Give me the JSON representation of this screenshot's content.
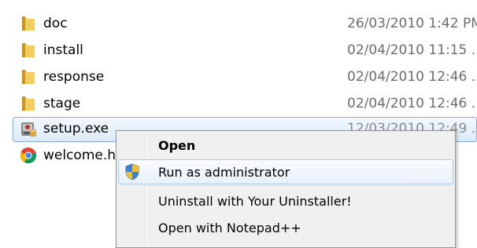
{
  "files": [
    {
      "name": "doc",
      "date": "26/03/2010 1:42 PM",
      "icon": "folder-icon"
    },
    {
      "name": "install",
      "date": "02/04/2010 11:15 ...",
      "icon": "folder-icon"
    },
    {
      "name": "response",
      "date": "02/04/2010 12:46 ...",
      "icon": "folder-icon"
    },
    {
      "name": "stage",
      "date": "02/04/2010 12:46 ...",
      "icon": "folder-icon"
    },
    {
      "name": "setup.exe",
      "date": "12/03/2010 12:49 ...",
      "icon": "setup-exe-icon"
    },
    {
      "name": "welcome.html",
      "date": "",
      "icon": "chrome-icon"
    }
  ],
  "context_menu": {
    "items": [
      {
        "label": "Open",
        "bold": true
      },
      {
        "label": "Run as administrator",
        "icon": "uac-shield-icon",
        "highlighted": true
      },
      {
        "label": "Uninstall with Your Uninstaller!"
      },
      {
        "label": "Open with Notepad++"
      }
    ]
  },
  "colors": {
    "selection_fill": "#dbeafc",
    "selection_border": "#84acdd",
    "menu_background": "#f0f0f0",
    "menu_border": "#979797",
    "date_text": "#6d6d6d"
  }
}
